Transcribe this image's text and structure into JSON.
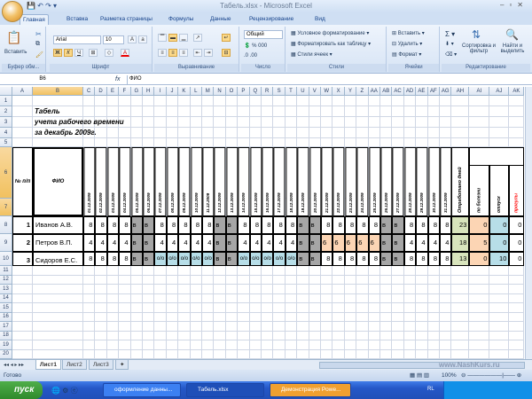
{
  "window": {
    "title": "Табель.xlsx - Microsoft Excel"
  },
  "ribbon": {
    "tabs": [
      "Главная",
      "Вставка",
      "Разметка страницы",
      "Формулы",
      "Данные",
      "Рецензирование",
      "Вид"
    ],
    "active_tab": "Главная",
    "paste": "Вставить",
    "font_name": "Arial",
    "font_size": "10",
    "number_format": "Общий",
    "styles": [
      "Условное форматирование",
      "Форматировать как таблицу",
      "Стили ячеек"
    ],
    "cells": [
      "Вставить",
      "Удалить",
      "Формат"
    ],
    "sort": "Сортировка и фильтр",
    "find": "Найти и выделить",
    "groups": [
      "Буфер обм...",
      "Шрифт",
      "Выравнивание",
      "Число",
      "Стили",
      "Ячейки",
      "Редактирование"
    ]
  },
  "formula_bar": {
    "name_box": "B6",
    "fx": "fx",
    "value": "ФИО"
  },
  "columns": [
    "A",
    "B",
    "C",
    "D",
    "E",
    "F",
    "G",
    "H",
    "I",
    "J",
    "K",
    "L",
    "M",
    "N",
    "O",
    "P",
    "Q",
    "R",
    "S",
    "T",
    "U",
    "V",
    "W",
    "X",
    "Y",
    "Z",
    "AA",
    "AB",
    "AC",
    "AD",
    "AE",
    "AF",
    "AG",
    "AH",
    "AI",
    "AJ",
    "AK"
  ],
  "rows": [
    "1",
    "2",
    "3",
    "4",
    "5",
    "6",
    "7",
    "8",
    "9",
    "10",
    "11",
    "12",
    "13",
    "14",
    "15",
    "16",
    "17",
    "18",
    "19",
    "20"
  ],
  "sheet": {
    "title_lines": [
      "Табель",
      "учета рабочего времени",
      "за декабрь 2009г."
    ],
    "header_num": "№ п/п",
    "header_fio": "ФИО",
    "dates": [
      "01.12.2009",
      "02.12.2009",
      "03.12.2009",
      "04.12.2009",
      "05.12.2009",
      "06.12.2009",
      "07.12.2009",
      "08.12.2009",
      "09.12.2009",
      "10.12.2009",
      "11.12.2009",
      "12.12.2009",
      "13.12.2009",
      "14.12.2009",
      "15.12.2009",
      "16.12.2009",
      "17.12.2009",
      "18.12.2009",
      "19.12.2009",
      "20.12.2009",
      "21.12.2009",
      "22.12.2009",
      "23.12.2009",
      "24.12.2009",
      "25.12.2009",
      "26.12.2009",
      "27.12.2009",
      "28.12.2009",
      "29.12.2009",
      "30.12.2009",
      "31.12.2009"
    ],
    "header_worked": "Отработано дней",
    "header_absence": "Неявки",
    "absence_cols": [
      "по болезни",
      "отпуск",
      "прогулы"
    ],
    "employees": [
      {
        "n": "1",
        "name": "Иванов А.В.",
        "days": [
          "8",
          "8",
          "8",
          "8",
          "в",
          "в",
          "8",
          "8",
          "8",
          "8",
          "8",
          "в",
          "в",
          "8",
          "8",
          "8",
          "8",
          "8",
          "в",
          "в",
          "8",
          "8",
          "8",
          "8",
          "8",
          "в",
          "в",
          "8",
          "8",
          "8",
          "8"
        ],
        "worked": "23",
        "sick": "0",
        "vacation": "0",
        "absent": "0"
      },
      {
        "n": "2",
        "name": "Петров В.П.",
        "days": [
          "4",
          "4",
          "4",
          "4",
          "в",
          "в",
          "4",
          "4",
          "4",
          "4",
          "4",
          "в",
          "в",
          "4",
          "4",
          "4",
          "4",
          "4",
          "в",
          "в",
          "6",
          "6",
          "6",
          "6",
          "6",
          "в",
          "в",
          "4",
          "4",
          "4",
          "4"
        ],
        "worked": "18",
        "sick": "5",
        "vacation": "0",
        "absent": "0"
      },
      {
        "n": "3",
        "name": "Сидоров Е.С.",
        "days": [
          "8",
          "8",
          "8",
          "8",
          "в",
          "в",
          "о/о",
          "о/о",
          "о/о",
          "о/о",
          "о/о",
          "в",
          "в",
          "о/о",
          "о/о",
          "о/о",
          "о/о",
          "о/о",
          "в",
          "в",
          "8",
          "8",
          "8",
          "8",
          "8",
          "в",
          "в",
          "8",
          "8",
          "8",
          "8"
        ],
        "worked": "13",
        "sick": "0",
        "vacation": "10",
        "absent": "0"
      }
    ]
  },
  "colors": {
    "weekend": "#a6a6a6",
    "vacation": "#b7dee8",
    "sick": "#fcd5b4",
    "worked": "#d8e4bc",
    "absent_label": "#ff0000"
  },
  "sheet_tabs": [
    "Лист1",
    "Лист2",
    "Лист3"
  ],
  "status": {
    "ready": "Готово",
    "zoom": "100%"
  },
  "watermark": "www.NashKurs.ru",
  "taskbar": {
    "start": "пуск",
    "tasks": [
      "оформление данны...",
      "Табель.xlsx",
      "Демонстрация Powe..."
    ],
    "lang": "RL"
  }
}
